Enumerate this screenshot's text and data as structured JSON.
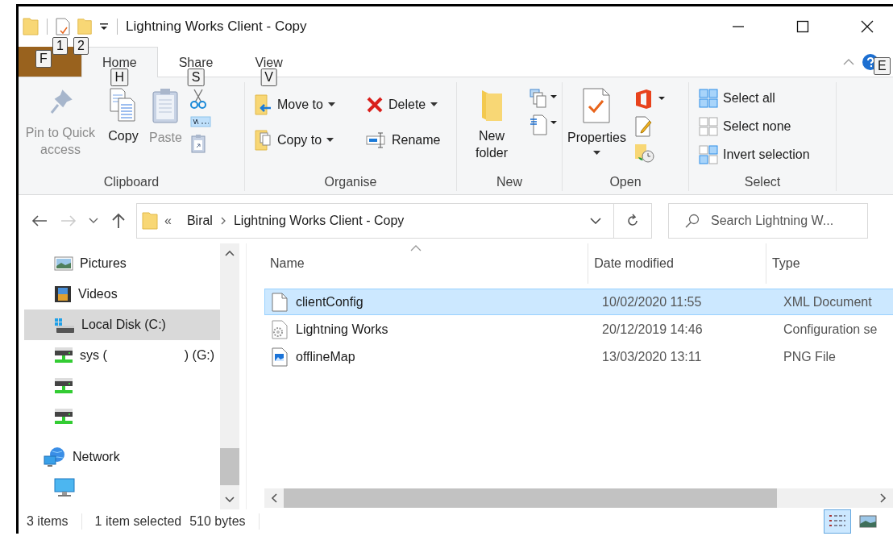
{
  "quick_access": {
    "keytips": [
      "1",
      "2"
    ]
  },
  "window": {
    "title": "Lightning Works Client - Copy"
  },
  "file_tab": {
    "keytip": "F"
  },
  "tabs": [
    {
      "label": "Home",
      "keytip": "H",
      "selected": true
    },
    {
      "label": "Share",
      "keytip": "S",
      "selected": false
    },
    {
      "label": "View",
      "keytip": "V",
      "selected": false
    }
  ],
  "help": {
    "keytip": "E"
  },
  "ribbon": {
    "groups": [
      {
        "kind": "clipboard",
        "label": "Clipboard",
        "buttons": [
          {
            "label": "Pin to Quick access",
            "disabled": true
          },
          {
            "label": "Copy",
            "disabled": false
          },
          {
            "label": "Paste",
            "disabled": true
          }
        ]
      },
      {
        "kind": "organise",
        "label": "Organise",
        "buttons": [
          {
            "label": "Move to",
            "dropdown": true
          },
          {
            "label": "Copy to",
            "dropdown": true
          },
          {
            "label": "Delete",
            "dropdown": true
          },
          {
            "label": "Rename",
            "dropdown": false
          }
        ]
      },
      {
        "kind": "new",
        "label": "New",
        "buttons": [
          {
            "label": "New folder"
          }
        ]
      },
      {
        "kind": "open",
        "label": "Open",
        "buttons": [
          {
            "label": "Properties",
            "dropdown": true
          }
        ]
      },
      {
        "kind": "select",
        "label": "Select",
        "buttons": [
          {
            "label": "Select all"
          },
          {
            "label": "Select none"
          },
          {
            "label": "Invert selection"
          }
        ]
      }
    ]
  },
  "address": {
    "overflow": "«",
    "path": [
      "Biral",
      "Lightning Works Client - Copy"
    ]
  },
  "search": {
    "placeholder": "Search Lightning W..."
  },
  "nav": [
    {
      "kind": "pictures",
      "label": "Pictures",
      "selected": false
    },
    {
      "kind": "videos",
      "label": "Videos",
      "selected": false
    },
    {
      "kind": "disk",
      "label": "Local Disk (C:)",
      "selected": true
    },
    {
      "kind": "network-drive",
      "label": "sys (",
      "label_end": ") (G:)",
      "selected": false
    },
    {
      "kind": "network-drive",
      "selected": false
    },
    {
      "kind": "network-drive",
      "selected": false
    },
    {
      "kind": "network",
      "label": "Network",
      "selected": false,
      "children": [
        {
          "kind": "computer",
          "selected": false
        }
      ]
    }
  ],
  "columns": [
    {
      "label": "Name",
      "sorted": true
    },
    {
      "label": "Date modified",
      "sorted": false
    },
    {
      "label": "Type",
      "sorted": false
    }
  ],
  "files": [
    {
      "kind": "document",
      "name": "clientConfig",
      "date": "10/02/2020 11:55",
      "type": "XML Document",
      "selected": true
    },
    {
      "kind": "config",
      "name": "Lightning Works",
      "date": "20/12/2019 14:46",
      "type": "Configuration se",
      "selected": false
    },
    {
      "kind": "image",
      "name": "offlineMap",
      "date": "13/03/2020 13:11",
      "type": "PNG File",
      "selected": false
    }
  ],
  "status": {
    "count": "3 items",
    "selection": "1 item selected",
    "size": "510 bytes"
  },
  "views": [
    {
      "kind": "details",
      "selected": true
    },
    {
      "kind": "large-icons",
      "selected": false
    }
  ]
}
